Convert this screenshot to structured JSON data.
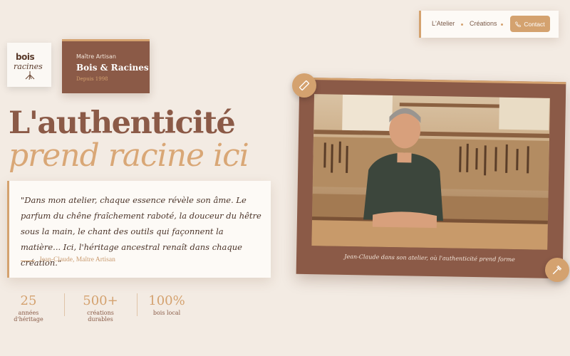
{
  "nav": {
    "links": [
      "L'Atelier",
      "Créations"
    ],
    "contact_label": "Contact"
  },
  "logo": {
    "line1": "bois",
    "line2": "racines"
  },
  "brand": {
    "subtitle": "Maître Artisan",
    "name": "Bois & Racines",
    "since": "Depuis 1998"
  },
  "hero": {
    "title_line1": "L'authenticité",
    "title_line2": "prend racine ici"
  },
  "quote": {
    "text": "\"Dans mon atelier, chaque essence révèle son âme. Le parfum du chêne fraîchement raboté, la douceur du hêtre sous la main, le chant des outils qui façonnent la matière... Ici, l'héritage ancestral renaît dans chaque création.\"",
    "author": "Jean-Claude, Maître Artisan"
  },
  "stats": [
    {
      "value": "25",
      "label": "années d'héritage"
    },
    {
      "value": "500+",
      "label": "créations durables"
    },
    {
      "value": "100%",
      "label": "bois local"
    }
  ],
  "photo": {
    "caption": "Jean-Claude dans son atelier, où l'authenticité prend forme"
  },
  "colors": {
    "background": "#f3ebe3",
    "brown": "#8b5a47",
    "gold": "#d4a26f"
  }
}
